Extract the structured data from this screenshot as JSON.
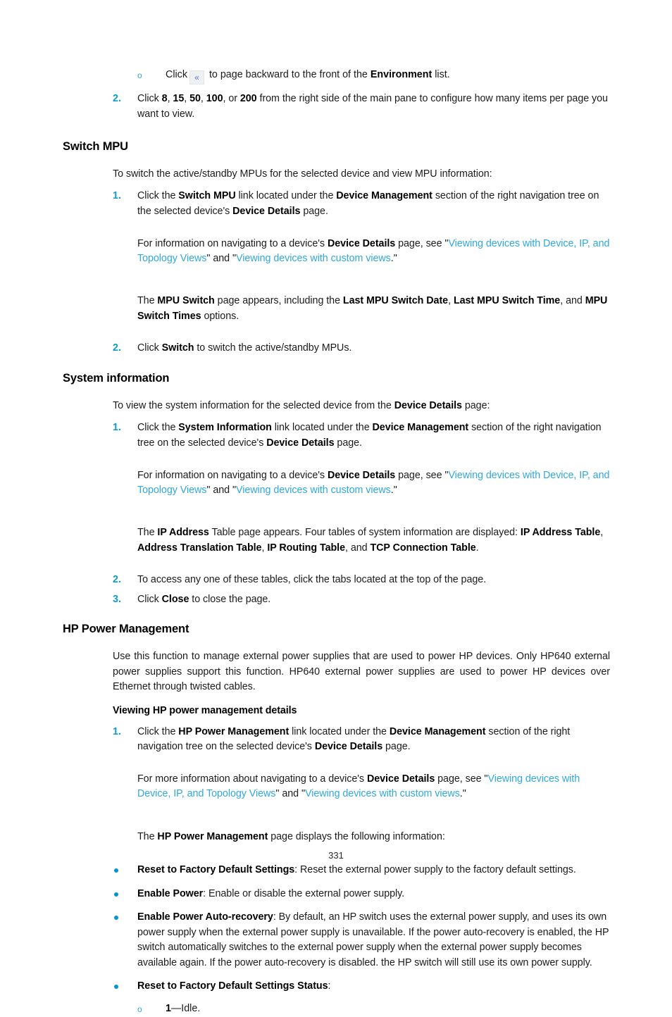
{
  "document": {
    "page_number": "331"
  },
  "top_list": {
    "sub_bullet": {
      "marker": "o",
      "text_before": "Click",
      "button_glyph": "«",
      "button_name": "page-backward-button",
      "text_after_1": " to page backward to the front of the ",
      "bold_1": "Environment",
      "text_after_2": " list."
    },
    "item_2": {
      "number": "2.",
      "t1": "Click ",
      "b1": "8",
      "t2": ", ",
      "b2": "15",
      "t3": ", ",
      "b3": "50",
      "t4": ", ",
      "b4": "100",
      "t5": ", or ",
      "b5": "200",
      "t6": " from the right side of the main pane to configure how many items per page you want to view."
    }
  },
  "switch_mpu": {
    "heading": "Switch MPU",
    "intro": "To switch the active/standby MPUs for the selected device and view MPU information:",
    "step1": {
      "number": "1.",
      "t1": "Click the ",
      "b1": "Switch MPU",
      "t2": " link located under the ",
      "b2": "Device Management",
      "t3": " section of the right navigation tree on the selected device's ",
      "b3": "Device Details",
      "t4": " page."
    },
    "ref": {
      "t1": "For information on navigating to a device's ",
      "b1": "Device Details",
      "t2": " page, see \"",
      "link1": "Viewing devices with Device, IP, and Topology Views",
      "t3": "\" and \"",
      "link2": "Viewing devices with custom views",
      "t4": ".\""
    },
    "result": {
      "t1": "The ",
      "b1": "MPU Switch",
      "t2": " page appears, including the ",
      "b2": "Last MPU Switch Date",
      "t3": ", ",
      "b3": "Last MPU Switch Time",
      "t4": ", and ",
      "b4": "MPU Switch Times",
      "t5": " options."
    },
    "step2": {
      "number": "2.",
      "t1": "Click ",
      "b1": "Switch",
      "t2": " to switch the active/standby MPUs."
    }
  },
  "system_information": {
    "heading": "System information",
    "intro": {
      "t1": "To view the system information for the selected device from the ",
      "b1": "Device Details",
      "t2": " page:"
    },
    "step1": {
      "number": "1.",
      "t1": "Click the ",
      "b1": "System Information",
      "t2": " link located under the ",
      "b2": "Device Management",
      "t3": " section of the right navigation tree on the selected device's ",
      "b3": "Device Details",
      "t4": " page."
    },
    "ref": {
      "t1": "For information on navigating to a device's ",
      "b1": "Device Details",
      "t2": " page, see \"",
      "link1": "Viewing devices with Device, IP, and Topology Views",
      "t3": "\" and \"",
      "link2": "Viewing devices with custom views",
      "t4": ".\""
    },
    "result": {
      "t1": "The ",
      "b1": "IP Address",
      "t2": " Table page appears. Four tables of system information are displayed: ",
      "b2": "IP Address Table",
      "t3": ", ",
      "b3": "Address Translation Table",
      "t4": ", ",
      "b4": "IP Routing Table",
      "t5": ", and ",
      "b5": "TCP Connection Table",
      "t6": "."
    },
    "step2": {
      "number": "2.",
      "t1": "To access any one of these tables, click the tabs located at the top of the page."
    },
    "step3": {
      "number": "3.",
      "t1": "Click ",
      "b1": "Close",
      "t2": " to close the page."
    }
  },
  "hp_power_management": {
    "heading": "HP Power Management",
    "intro": "Use this function to manage external power supplies that are used to power HP devices. Only HP640 external power supplies support this function. HP640 external power supplies are used to power HP devices over Ethernet through twisted cables.",
    "subheading": "Viewing HP power management details",
    "step1": {
      "number": "1.",
      "t1": "Click the ",
      "b1": "HP Power Management",
      "t2": " link located under the ",
      "b2": "Device Management",
      "t3": " section of the right navigation tree on the selected device's ",
      "b3": "Device Details",
      "t4": " page."
    },
    "ref": {
      "t1": "For more information about navigating to a device's ",
      "b1": "Device Details",
      "t2": " page, see \"",
      "link1": "Viewing devices with Device, IP, and Topology Views",
      "t3": "\" and \"",
      "link2": "Viewing devices with custom views",
      "t4": ".\""
    },
    "result": {
      "t1": "The ",
      "b1": "HP Power Management",
      "t2": " page displays the following information:"
    },
    "bullets": [
      {
        "bold": "Reset to Factory Default Settings",
        "text": ": Reset the external power supply to the factory default settings."
      },
      {
        "bold": "Enable Power",
        "text": ": Enable or disable the external power supply."
      },
      {
        "bold": "Enable Power Auto-recovery",
        "text": ": By default, an HP switch uses the external power supply, and uses its own power supply when the external power supply is unavailable. If the power auto-recovery is enabled, the HP switch automatically switches to the external power supply when the external power supply becomes available again. If the power auto-recovery is disabled. the HP switch will still use its own power supply."
      },
      {
        "bold": "Reset to Factory Default Settings Status",
        "text": ":"
      }
    ],
    "status_sub": {
      "marker": "o",
      "bold": "1",
      "text": "—Idle."
    }
  },
  "colors": {
    "list_number": "#0b9dd1",
    "link": "#2fa8e0",
    "bullet": "#0096cd",
    "text": "#1b1b1b"
  }
}
